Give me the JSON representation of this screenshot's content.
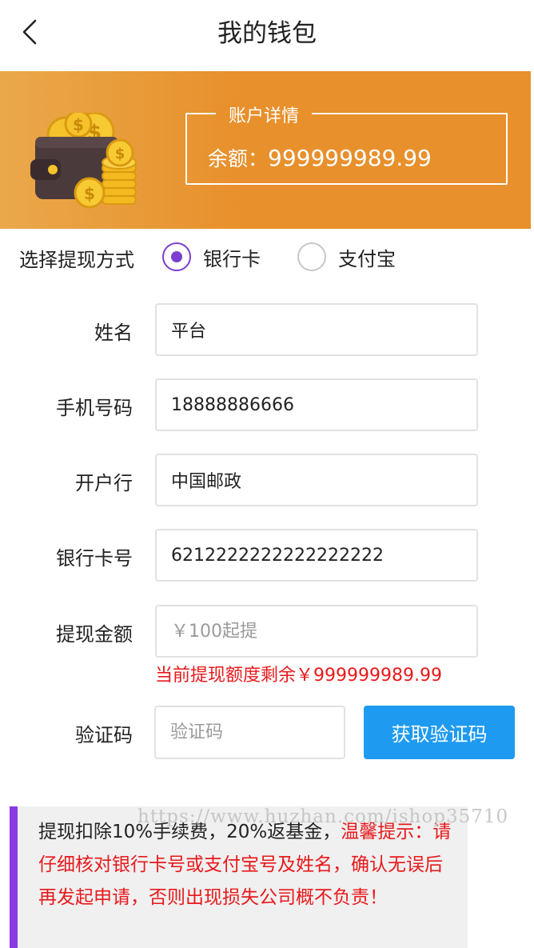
{
  "header": {
    "title": "我的钱包",
    "back_icon": "chevron-left-icon"
  },
  "account": {
    "legend": "账户详情",
    "balance_label": "余额：",
    "balance_value": "999999989.99"
  },
  "withdraw_method": {
    "label": "选择提现方式",
    "options": [
      {
        "label": "银行卡",
        "checked": true
      },
      {
        "label": "支付宝",
        "checked": false
      }
    ],
    "accent_color": "#7a3fd0"
  },
  "form": {
    "name_label": "姓名",
    "name_value": "平台",
    "phone_label": "手机号码",
    "phone_value": "18888886666",
    "bank_label": "开户行",
    "bank_value": "中国邮政",
    "card_label": "银行卡号",
    "card_value": "6212222222222222222",
    "amount_label": "提现金额",
    "amount_placeholder": "￥100起提",
    "remaining_text": "当前提现额度剩余￥999999989.99",
    "code_label": "验证码",
    "code_placeholder": "验证码",
    "code_button": "获取验证码"
  },
  "notice": {
    "text_normal": "提现扣除10%手续费，20%返基金，",
    "text_warning": "温馨提示：请仔细核对银行卡号或支付宝号及姓名，确认无误后再发起申请，否则出现损失公司概不负责！"
  },
  "watermark": "https://www.huzhan.com/ishop35710",
  "colors": {
    "banner": "#e8902c",
    "button": "#1e9bf0",
    "warning": "#e8191b"
  }
}
